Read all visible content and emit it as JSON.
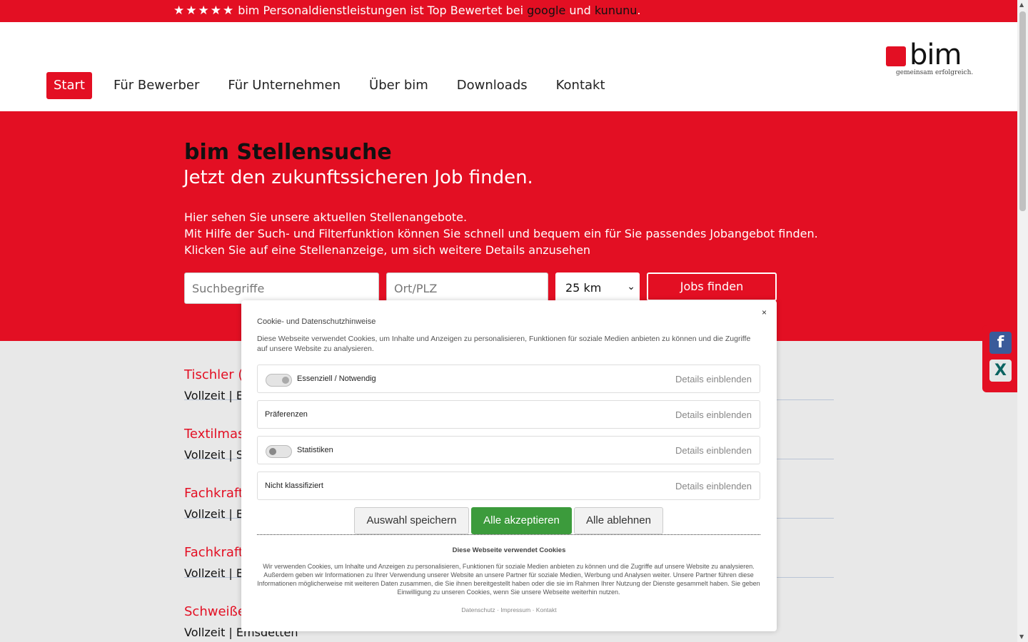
{
  "topbar": {
    "stars": "★★★★★",
    "text_before": "bim Personaldienstleistungen ist Top Bewertet bei ",
    "link_google": "google",
    "text_middle": " und ",
    "link_kununu": "kununu",
    "text_after": "."
  },
  "nav": {
    "items": [
      "Start",
      "Für Bewerber",
      "Für Unternehmen",
      "Über bim",
      "Downloads",
      "Kontakt"
    ]
  },
  "logo": {
    "word": "bim",
    "tagline": "gemeinsam erfolgreich."
  },
  "hero": {
    "title": "bim Stellensuche",
    "subtitle": "Jetzt den zukunftssicheren Job finden.",
    "intro_line1": "Hier sehen Sie unsere aktuellen Stellenangebote.",
    "intro_line2": "Mit Hilfe der Such- und Filterfunktion können Sie schnell und bequem ein für Sie passendes Jobangebot finden. Klicken Sie auf eine Stellenanzeige, um sich weitere Details anzusehen"
  },
  "search": {
    "keywords_placeholder": "Suchbegriffe",
    "location_placeholder": "Ort/PLZ",
    "radius_value": "25 km",
    "submit_label": "Jobs finden"
  },
  "jobs": [
    {
      "title": "Tischler (m",
      "meta": "Vollzeit  |  E"
    },
    {
      "title": "Textilmas",
      "meta": "Vollzeit  |  S"
    },
    {
      "title": "Fachkraft",
      "meta": "Vollzeit  |  E"
    },
    {
      "title": "Fachkraft",
      "meta": "Vollzeit  |  E"
    },
    {
      "title": "Schweiße",
      "meta": "Vollzeit  |  Emsdetten"
    }
  ],
  "social": {
    "facebook": "f",
    "xing": "X"
  },
  "cookie": {
    "close": "×",
    "title": "Cookie- und Datenschutzhinweise",
    "description": "Diese Webseite verwendet Cookies, um Inhalte und Anzeigen zu personalisieren, Funktionen für soziale Medien anbieten zu können und die Zugriffe auf unsere Website zu analysieren.",
    "categories": [
      {
        "label": "Essenziell / Notwendig",
        "details": "Details einblenden"
      },
      {
        "label": "Präferenzen",
        "details": "Details einblenden"
      },
      {
        "label": "Statistiken",
        "details": "Details einblenden"
      },
      {
        "label": "Nicht klassifiziert",
        "details": "Details einblenden"
      }
    ],
    "save_label": "Auswahl speichern",
    "accept_label": "Alle akzeptieren",
    "reject_label": "Alle ablehnen",
    "bottom_title": "Diese Webseite verwendet Cookies",
    "bottom_text": "Wir verwenden Cookies, um Inhalte und Anzeigen zu personalisieren, Funktionen für soziale Medien anbieten zu können und die Zugriffe auf unsere Website zu analysieren. Außerdem geben wir Informationen zu Ihrer Verwendung unserer Website an unsere Partner für soziale Medien, Werbung und Analysen weiter. Unsere Partner führen diese Informationen möglicherweise mit weiteren Daten zusammen, die Sie ihnen bereitgestellt haben oder die sie im Rahmen Ihrer Nutzung der Dienste gesammelt haben. Sie geben Einwilligung zu unseren Cookies, wenn Sie unsere Webseite weiterhin nutzen.",
    "link_privacy": "Datenschutz",
    "link_imprint": "Impressum",
    "link_contact": "Kontakt",
    "link_sep": " · "
  },
  "colors": {
    "brand": "#e30f23",
    "accept": "#3c9b3c",
    "content_bg": "#e8e8e8"
  }
}
